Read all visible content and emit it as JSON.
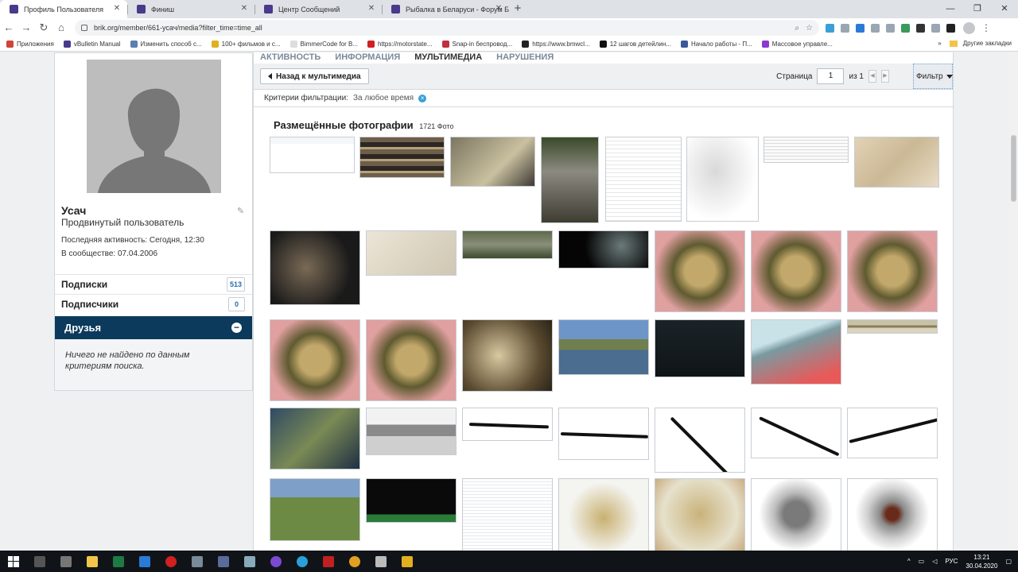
{
  "browser": {
    "tabs": [
      {
        "title": "Профиль Пользователя",
        "active": true
      },
      {
        "title": "Финиш",
        "active": false
      },
      {
        "title": "Центр Сообщений",
        "active": false
      },
      {
        "title": "Рыбалка в Беларуси - Форум Бе",
        "active": false
      }
    ],
    "new_tab_label": "+",
    "url": "brik.org/member/661-усач/media?filter_time=time_all",
    "bookmarks": [
      "Приложения",
      "vBulletin Manual",
      "Изменить способ с...",
      "100+ фильмов и с...",
      "BimmerCode for B...",
      "https://motorstate...",
      "Snap-in беспровод...",
      "https://www.bmwcl...",
      "12 шагов детейлин...",
      "Начало работы - П...",
      "Массовое управле..."
    ],
    "bookmarks_more": "»",
    "other_bookmarks": "Другие закладки"
  },
  "profile": {
    "name": "Усач",
    "rank": "Продвинутый пользователь",
    "last_activity": "Последняя активность: Сегодня, 12:30",
    "member_since": "В сообществе: 07.04.2006",
    "subscriptions_label": "Подписки",
    "subscriptions_count": "513",
    "subscribers_label": "Подписчики",
    "subscribers_count": "0",
    "friends_label": "Друзья",
    "no_results": "Ничего не найдено по данным критериям поиска."
  },
  "main": {
    "subtabs": [
      "АКТИВНОСТЬ",
      "ИНФОРМАЦИЯ",
      "МУЛЬТИМЕДИА",
      "НАРУШЕНИЯ"
    ],
    "selected_subtab": "МУЛЬТИМЕДИА",
    "back_button": "Назад к мультимедиа",
    "page_label": "Страница",
    "page_value": "1",
    "page_of": "из 1",
    "filter_label": "Фильтр",
    "criteria_label": "Критерии фильтрации:",
    "criteria_value": "За любое время",
    "gallery_title": "Размещённые фотографии",
    "gallery_count": "1721 Фото"
  },
  "taskbar": {
    "language": "РУС",
    "time": "13:21",
    "date": "30.04.2020"
  }
}
